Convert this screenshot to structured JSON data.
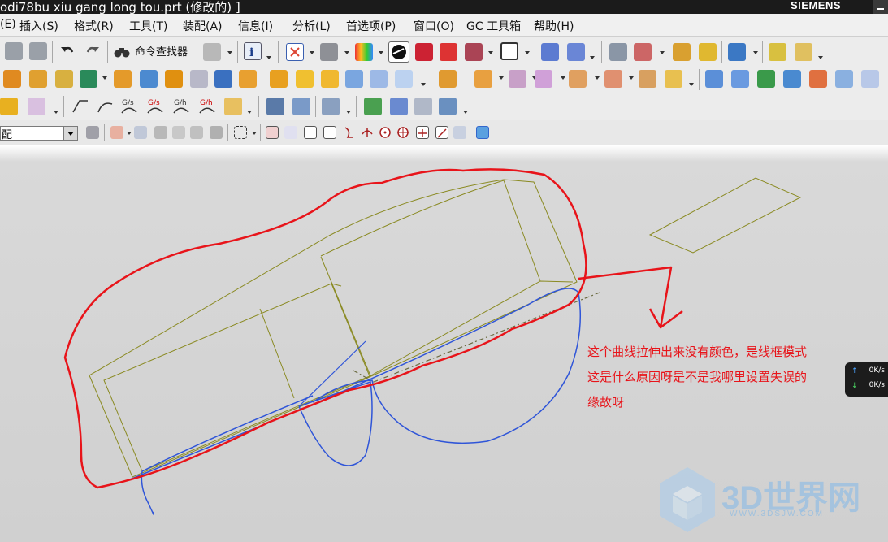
{
  "window": {
    "title": "odi78bu xiu gang long tou.prt (修改的) ]",
    "brand": "SIEMENS"
  },
  "menubar": {
    "items": [
      "(E)",
      "插入(S)",
      "格式(R)",
      "工具(T)",
      "装配(A)",
      "信息(I)",
      "分析(L)",
      "首选项(P)",
      "窗口(O)",
      "GC 工具箱",
      "帮助(H)"
    ]
  },
  "toolbar": {
    "command_finder_label": "命令查找器",
    "filter_combo_value": "配"
  },
  "annotation": {
    "note_lines": [
      "这个曲线拉伸出来没有颜色，是线框模式",
      "这是什么原因呀是不是我哪里设置失误的",
      "缘故呀"
    ],
    "highlight_color": "#e8141a"
  },
  "net_widget": {
    "upload": "0K/s",
    "download": "0K/s"
  },
  "watermark": {
    "text": "3D世界网",
    "url": "WWW.3DSJW.COM"
  },
  "colors": {
    "wireframe_edges": "#8a8a22",
    "blue_curves": "#2f55d8",
    "annotation_red": "#e8141a"
  }
}
